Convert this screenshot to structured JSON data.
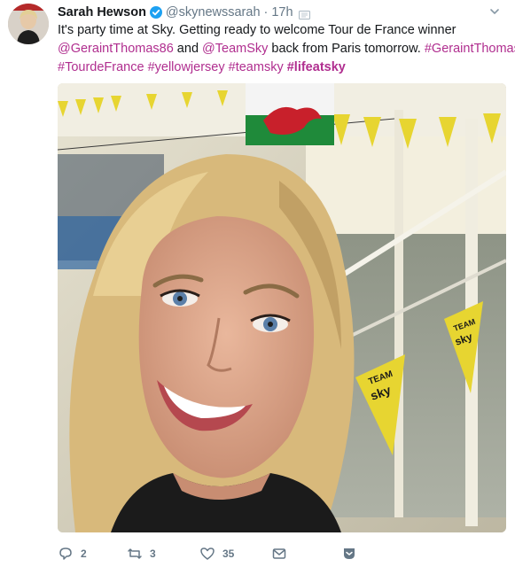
{
  "tweet": {
    "display_name": "Sarah Hewson",
    "handle": "@skynewssarah",
    "separator": "·",
    "time": "17h",
    "text_line1": "It's party time at Sky. Getting ready to welcome Tour de France winner",
    "mention1": "@GeraintThomas86",
    "and_text": " and ",
    "mention2": "@TeamSky",
    "back_text": " back from Paris tomorrow. ",
    "hashtag1": "#GeraintThomas",
    "hashtag2": "#TourdeFrance",
    "hashtag3": "#yellowjersey",
    "hashtag4": "#teamsky",
    "hashtag5": "#lifeatsky",
    "space": " "
  },
  "photo": {
    "flag_label": "Welsh flag",
    "pennant_text_line1": "TEAM",
    "pennant_text_line2": "sky"
  },
  "actions": {
    "reply_count": "2",
    "retweet_count": "3",
    "like_count": "35"
  },
  "colors": {
    "link": "#b02e8f",
    "verified": "#1da1f2",
    "muted": "#657786",
    "pennant": "#e7d531"
  },
  "icons": [
    "verified-icon",
    "translate-icon",
    "chevron-down-icon",
    "reply-icon",
    "retweet-icon",
    "like-icon",
    "message-icon",
    "bookmark-icon"
  ]
}
